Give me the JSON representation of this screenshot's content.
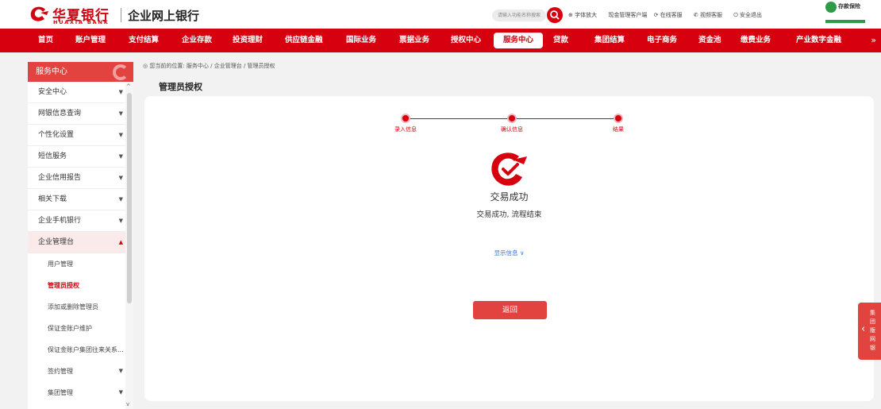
{
  "header": {
    "logo_cn": "华夏银行",
    "logo_en": "HUAXIA BANK",
    "site_name": "企业网上银行",
    "search_placeholder": "请输入功能名称搜索",
    "links": [
      "字体放大",
      "现金管理客户端",
      "在线客服",
      "视频客服",
      "安全退出"
    ],
    "deposit_badge": "存款保险"
  },
  "nav": {
    "items": [
      "首页",
      "账户管理",
      "支付结算",
      "企业存款",
      "投资理财",
      "供应链金融",
      "国际业务",
      "票据业务",
      "授权中心",
      "服务中心",
      "贷款",
      "集团结算",
      "电子商务",
      "资金池",
      "缴费业务",
      "产业数字金融"
    ],
    "active": "服务中心"
  },
  "sidebar": {
    "title": "服务中心",
    "items": [
      "安全中心",
      "网银信息查询",
      "个性化设置",
      "短信服务",
      "企业信用报告",
      "相关下载",
      "企业手机银行",
      "企业管理台"
    ],
    "subitems": [
      "用户管理",
      "管理员授权",
      "添加或删除管理员",
      "保证金账户维护",
      "保证金账户集团往来关系...",
      "签约管理",
      "集团管理"
    ],
    "active_subitem": "管理员授权"
  },
  "breadcrumb": "您当前的位置: 服务中心 / 企业管理台 / 管理员授权",
  "page_title": "管理员授权",
  "steps": [
    "录入信息",
    "确认信息",
    "结果"
  ],
  "result": {
    "title": "交易成功",
    "message": "交易成功, 流程结束",
    "show_info": "显示信息",
    "back_button": "返回"
  },
  "float_tab": "集团版网银",
  "colors": {
    "brand_red": "#d7000f",
    "accent_red": "#e2433f",
    "link_blue": "#2c7be5"
  }
}
